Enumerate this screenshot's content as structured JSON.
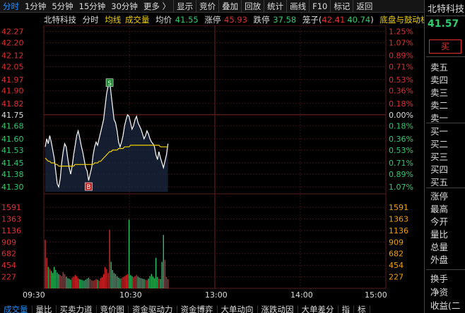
{
  "toolbar": {
    "items": [
      "分时",
      "1分钟",
      "5分钟",
      "15分钟",
      "30分钟",
      "更多 〉"
    ],
    "active": 0,
    "tools": [
      "显示",
      "竞价",
      "叠加",
      "回放",
      "统计",
      "画线",
      "F10",
      "标记",
      "返回"
    ]
  },
  "info": {
    "name": "北特科技",
    "mode": "分时",
    "avg_tag": "均线",
    "vol_tag": "成交量",
    "avg_label": "均价",
    "avg_value": "41.55",
    "limit_up_label": "涨停",
    "limit_up_value": "45.93",
    "limit_down_label": "跌停",
    "limit_down_value": "37.58",
    "box_label": "笼子",
    "box_open": "(",
    "box_low": "42.41",
    "box_high": "40.74",
    "box_close": ")",
    "concept": "底盘与鼓动机系统"
  },
  "right_panel": {
    "name": "北特科技",
    "price": "41.57",
    "buy_button": "买",
    "sell_levels": [
      "卖五",
      "卖四",
      "卖三",
      "卖二",
      "卖一"
    ],
    "buy_levels": [
      "买一",
      "买二",
      "买三",
      "买四",
      "买五"
    ],
    "stats": [
      "涨停",
      "最高",
      "今开",
      "量比",
      "总量",
      "外盘"
    ],
    "more": [
      "换手",
      "净资",
      "收益(二"
    ]
  },
  "tabs": [
    "成交量",
    "量比",
    "买卖力道",
    "竞价图",
    "资金驱动力",
    "资金博弈",
    "大单动向",
    "涨跌动因",
    "大单差分",
    "指",
    "标"
  ],
  "active_tab": 0,
  "chart_data": {
    "type": "line",
    "price_ticks": [
      "42.27",
      "42.20",
      "42.12",
      "42.05",
      "41.97",
      "41.90",
      "41.82",
      "41.75",
      "41.68",
      "41.60",
      "41.53",
      "41.45",
      "41.38",
      "41.30"
    ],
    "pct_ticks": [
      "1.25%",
      "1.07%",
      "0.89%",
      "0.71%",
      "0.53%",
      "0.36%",
      "0.18%",
      "0.00%",
      "0.18%",
      "0.36%",
      "0.53%",
      "0.71%",
      "0.89%",
      "1.07%"
    ],
    "prev_close": 41.75,
    "ylim": [
      41.27,
      42.29
    ],
    "volume_ticks": [
      "1591",
      "1363",
      "1136",
      "909",
      "682",
      "454",
      "227"
    ],
    "volume_max": 1800,
    "time_labels": [
      "09:30",
      "10:30",
      "13:00",
      "14:00",
      "15:00"
    ],
    "minutes_total": 240,
    "price": [
      41.55,
      41.6,
      41.57,
      41.62,
      41.58,
      41.53,
      41.48,
      41.4,
      41.32,
      41.3,
      41.35,
      41.45,
      41.52,
      41.57,
      41.55,
      41.48,
      41.42,
      41.38,
      41.43,
      41.5,
      41.56,
      41.62,
      41.65,
      41.61,
      41.56,
      41.52,
      41.47,
      41.42,
      41.4,
      41.34,
      41.38,
      41.42,
      41.5,
      41.55,
      41.58,
      41.56,
      41.6,
      41.64,
      41.68,
      41.72,
      41.8,
      41.88,
      41.93,
      41.97,
      41.88,
      41.8,
      41.72,
      41.7,
      41.65,
      41.58,
      41.55,
      41.58,
      41.62,
      41.68,
      41.72,
      41.75,
      41.74,
      41.7,
      41.66,
      41.68,
      41.72,
      41.74,
      41.7,
      41.68,
      41.66,
      41.63,
      41.6,
      41.62,
      41.65,
      41.63,
      41.6,
      41.58,
      41.57,
      41.55,
      41.5,
      41.47,
      41.52,
      41.48,
      41.45,
      41.42,
      41.46,
      41.5,
      41.57
    ],
    "avg": [
      41.48,
      41.47,
      41.46,
      41.46,
      41.45,
      41.45,
      41.45,
      41.44,
      41.44,
      41.43,
      41.43,
      41.43,
      41.43,
      41.43,
      41.43,
      41.43,
      41.43,
      41.43,
      41.43,
      41.43,
      41.44,
      41.44,
      41.44,
      41.44,
      41.44,
      41.44,
      41.44,
      41.44,
      41.44,
      41.44,
      41.44,
      41.44,
      41.44,
      41.45,
      41.45,
      41.45,
      41.46,
      41.46,
      41.47,
      41.48,
      41.49,
      41.5,
      41.51,
      41.52,
      41.52,
      41.53,
      41.53,
      41.53,
      41.53,
      41.54,
      41.54,
      41.54,
      41.54,
      41.55,
      41.55,
      41.55,
      41.55,
      41.56,
      41.56,
      41.56,
      41.56,
      41.56,
      41.56,
      41.56,
      41.56,
      41.56,
      41.56,
      41.56,
      41.56,
      41.56,
      41.56,
      41.56,
      41.56,
      41.56,
      41.56,
      41.56,
      41.56,
      41.55,
      41.55,
      41.55,
      41.55,
      41.55,
      41.55
    ],
    "volume": [
      950,
      600,
      420,
      380,
      340,
      300,
      420,
      360,
      310,
      280,
      260,
      240,
      320,
      280,
      230,
      200,
      190,
      170,
      210,
      230,
      260,
      240,
      200,
      180,
      170,
      160,
      150,
      170,
      190,
      210,
      180,
      160,
      150,
      160,
      180,
      170,
      150,
      200,
      220,
      280,
      420,
      380,
      300,
      1150,
      520,
      360,
      300,
      280,
      240,
      210,
      190,
      200,
      220,
      240,
      260,
      280,
      1350,
      260,
      240,
      220,
      240,
      260,
      230,
      210,
      200,
      190,
      180,
      170,
      160,
      190,
      240,
      280,
      230,
      200,
      600,
      220,
      190,
      180,
      520,
      1050,
      560,
      220,
      180
    ],
    "markers": [
      {
        "label": "S",
        "index": 43,
        "price": 41.97
      },
      {
        "label": "B",
        "index": 29,
        "price": 41.34
      }
    ]
  }
}
